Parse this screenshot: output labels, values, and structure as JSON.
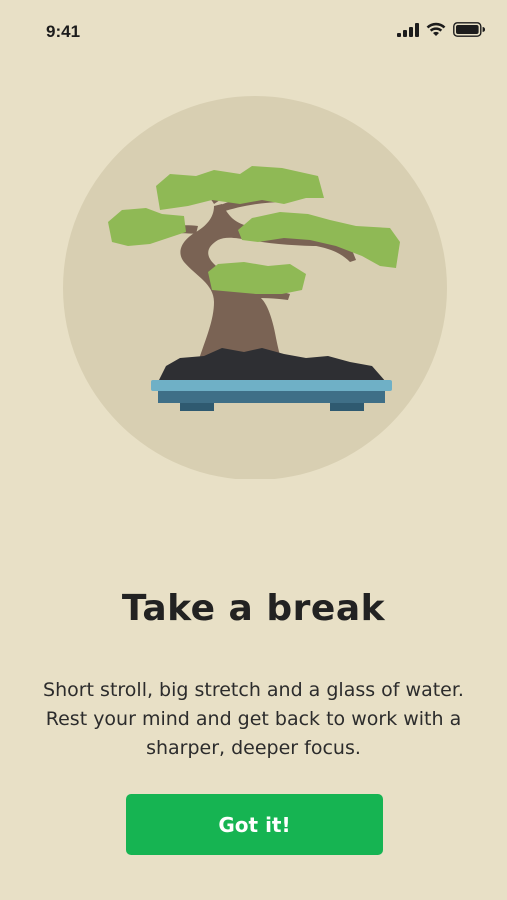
{
  "status_bar": {
    "time": "9:41",
    "icons": [
      "cellular-signal-icon",
      "wifi-icon",
      "battery-icon"
    ]
  },
  "illustration": {
    "subject": "bonsai-tree-illustration",
    "colors": {
      "circle": "#D8CFB2",
      "foliage": "#8FB955",
      "trunk": "#7A6354",
      "soil": "#2E2F33",
      "pot_rim": "#6FB0C6",
      "pot_body": "#3F6F87",
      "pot_feet": "#2F5A70"
    }
  },
  "content": {
    "title": "Take a break",
    "message_lines": [
      "Short stroll, big stretch and a glass of water.",
      "Rest your mind and get back to work with a",
      "sharper, deeper focus."
    ]
  },
  "actions": {
    "primary_label": "Got it!"
  },
  "theme": {
    "background": "#E8E0C6",
    "accent": "#16B452",
    "text": "#222222"
  }
}
